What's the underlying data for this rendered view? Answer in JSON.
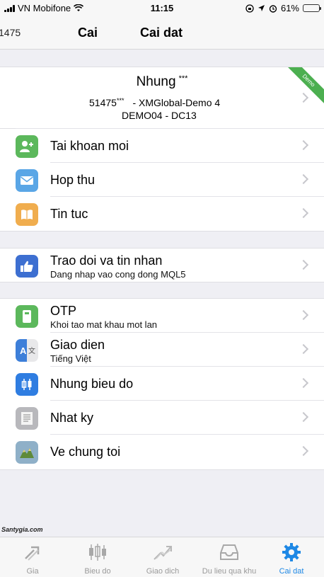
{
  "status_bar": {
    "carrier": "VN Mobifone",
    "time": "11:15",
    "battery": "61%",
    "battery_level": 0.61
  },
  "nav": {
    "prev_partial": "1475",
    "back_label": "Cai",
    "title": "Cai dat"
  },
  "account": {
    "name": "Nhung",
    "masked": "***",
    "number": "51475",
    "server": "- XMGlobal-Demo 4",
    "details": "DEMO04 - DC13",
    "badge": "Demo"
  },
  "group1": [
    {
      "label": "Tai khoan moi",
      "icon": "add-user-icon",
      "color": "#5cb85c"
    },
    {
      "label": "Hop thu",
      "icon": "mail-icon",
      "color": "#5aa6e6"
    },
    {
      "label": "Tin tuc",
      "icon": "book-icon",
      "color": "#f0ad4e"
    }
  ],
  "group2": [
    {
      "label": "Trao doi va tin nhan",
      "sub": "Dang nhap vao cong dong MQL5",
      "icon": "thumbs-up-icon",
      "color": "#3d6fd1"
    }
  ],
  "group3": [
    {
      "label": "OTP",
      "sub": "Khoi tao mat khau mot lan",
      "icon": "otp-icon",
      "color": "#5cb85c"
    },
    {
      "label": "Giao dien",
      "sub": "Tiếng Việt",
      "icon": "language-icon",
      "color": "#3d7fd9"
    },
    {
      "label": "Nhung bieu do",
      "icon": "candlestick-icon",
      "color": "#2f7de1"
    },
    {
      "label": "Nhat ky",
      "icon": "journal-icon",
      "color": "#b8b8bc"
    },
    {
      "label": "Ve chung toi",
      "icon": "about-icon",
      "color": "#8fb0c8"
    }
  ],
  "watermark": "Santygia.com",
  "tabs": [
    {
      "label": "Gia",
      "icon": "quotes-icon"
    },
    {
      "label": "Bieu do",
      "icon": "chart-icon"
    },
    {
      "label": "Giao dich",
      "icon": "trade-icon"
    },
    {
      "label": "Du lieu qua khu",
      "icon": "history-icon"
    },
    {
      "label": "Cai dat",
      "icon": "settings-icon",
      "active": true
    }
  ]
}
